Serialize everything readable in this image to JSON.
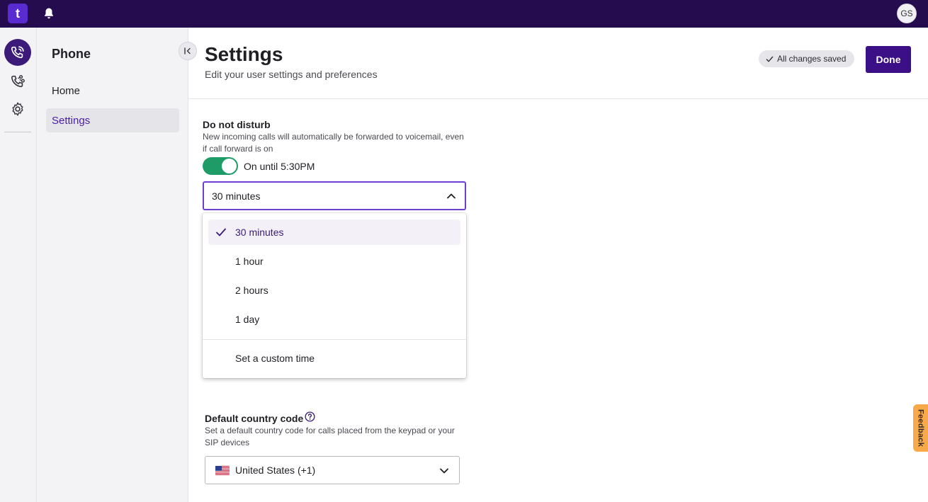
{
  "topbar": {
    "logo_text": "t",
    "avatar_initials": "GS",
    "colors": {
      "background": "#240c4f",
      "logo": "#5a2bd1"
    },
    "icons": [
      "bell-icon"
    ]
  },
  "rail": {
    "items": [
      {
        "icon": "phone-call-icon",
        "active": true
      },
      {
        "icon": "call-routing-icon",
        "active": false
      },
      {
        "icon": "gear-icon",
        "active": false
      }
    ]
  },
  "sidebar": {
    "title": "Phone",
    "items": [
      {
        "label": "Home",
        "active": false
      },
      {
        "label": "Settings",
        "active": true
      }
    ]
  },
  "header": {
    "title": "Settings",
    "subtitle": "Edit your user settings and preferences",
    "saved_status": "All changes saved",
    "done_label": "Done",
    "accent": "#3b0f86"
  },
  "dnd": {
    "title": "Do not disturb",
    "description": "New incoming calls will automatically be forwarded to voicemail, even if call forward is on",
    "toggle_on": true,
    "toggle_label": "On until 5:30PM",
    "toggle_color": "#1e9c68",
    "select_value": "30 minutes",
    "options": [
      "30 minutes",
      "1 hour",
      "2 hours",
      "1 day"
    ],
    "selected_option": "30 minutes",
    "custom_option": "Set a custom time"
  },
  "country": {
    "title": "Default country code",
    "description": "Set a default country code for calls placed from the keypad or your SIP devices",
    "value": "United States (+1)",
    "flag": "us-flag-icon"
  },
  "feedback": {
    "label": "Feedback",
    "color": "#f8a94a"
  }
}
